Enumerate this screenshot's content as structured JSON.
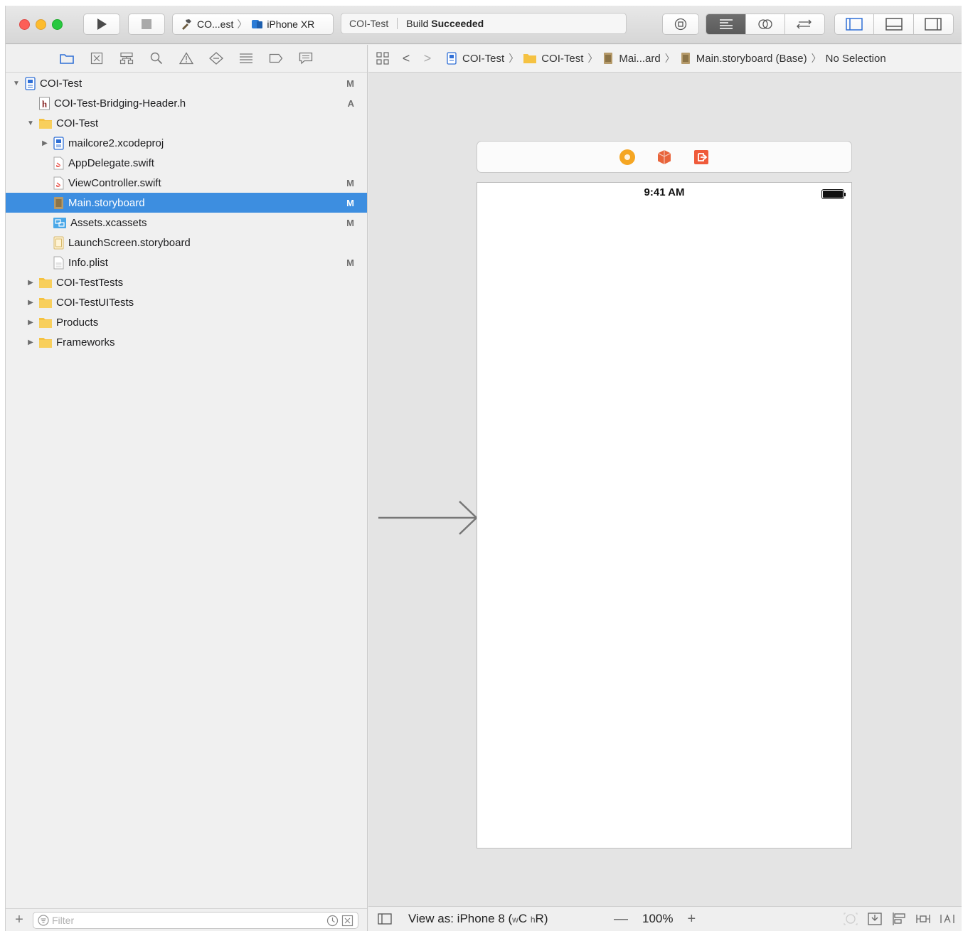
{
  "toolbar": {
    "scheme_name": "CO...est",
    "scheme_separator": "〉",
    "device_name": "iPhone XR",
    "activity_project": "COI-Test",
    "activity_status_prefix": "Build",
    "activity_status": "Succeeded"
  },
  "navigator": {
    "tree": [
      {
        "label": "COI-Test",
        "status": "M",
        "icon": "project-icon",
        "disclosure": "▼",
        "indent": 0
      },
      {
        "label": "COI-Test-Bridging-Header.h",
        "status": "A",
        "icon": "header-file-icon",
        "disclosure": "",
        "indent": 1
      },
      {
        "label": "COI-Test",
        "status": "",
        "icon": "folder-icon",
        "disclosure": "▼",
        "indent": 1
      },
      {
        "label": "mailcore2.xcodeproj",
        "status": "",
        "icon": "project-icon",
        "disclosure": "▶",
        "indent": 2
      },
      {
        "label": "AppDelegate.swift",
        "status": "",
        "icon": "swift-file-icon",
        "disclosure": "",
        "indent": 2
      },
      {
        "label": "ViewController.swift",
        "status": "M",
        "icon": "swift-file-icon",
        "disclosure": "",
        "indent": 2
      },
      {
        "label": "Main.storyboard",
        "status": "M",
        "icon": "storyboard-icon",
        "disclosure": "",
        "indent": 2,
        "selected": true
      },
      {
        "label": "Assets.xcassets",
        "status": "M",
        "icon": "assets-icon",
        "disclosure": "",
        "indent": 2
      },
      {
        "label": "LaunchScreen.storyboard",
        "status": "",
        "icon": "storyboard-light-icon",
        "disclosure": "",
        "indent": 2
      },
      {
        "label": "Info.plist",
        "status": "M",
        "icon": "plist-icon",
        "disclosure": "",
        "indent": 2
      },
      {
        "label": "COI-TestTests",
        "status": "",
        "icon": "folder-icon",
        "disclosure": "▶",
        "indent": 1
      },
      {
        "label": "COI-TestUITests",
        "status": "",
        "icon": "folder-icon",
        "disclosure": "▶",
        "indent": 1
      },
      {
        "label": "Products",
        "status": "",
        "icon": "folder-icon",
        "disclosure": "▶",
        "indent": 1
      },
      {
        "label": "Frameworks",
        "status": "",
        "icon": "folder-icon",
        "disclosure": "▶",
        "indent": 1
      }
    ],
    "filter_placeholder": "Filter",
    "add_label": "+"
  },
  "jumpbar": {
    "crumbs": [
      "COI-Test",
      "COI-Test",
      "Mai...ard",
      "Main.storyboard (Base)",
      "No Selection"
    ],
    "back": "<",
    "forward": ">",
    "separator": "〉"
  },
  "canvas": {
    "status_time": "9:41 AM"
  },
  "footer": {
    "view_as_prefix": "View as: iPhone 8 (",
    "w_prefix": "w",
    "w_value": "C",
    "h_prefix": "h",
    "h_value": "R",
    "view_as_suffix": ")",
    "zoom_minus": "—",
    "zoom_level": "100%",
    "zoom_plus": "+"
  },
  "colors": {
    "selection": "#3d8ee0",
    "folder": "#f5c242",
    "close": "#fc5f57",
    "minimize": "#fdbc2e",
    "zoom": "#28c840"
  }
}
